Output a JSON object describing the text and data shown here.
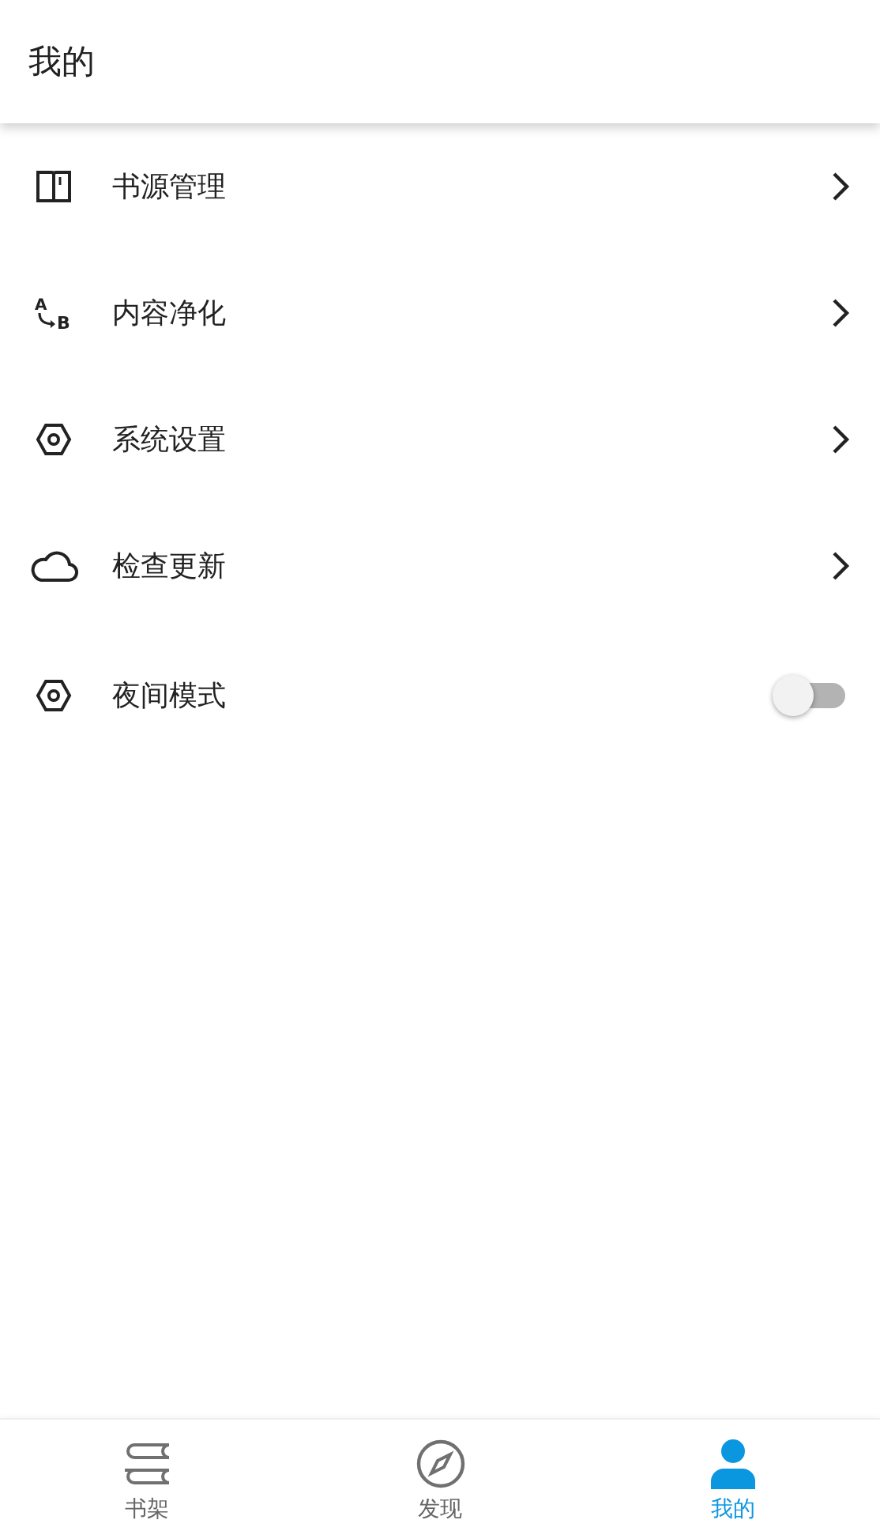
{
  "header": {
    "title": "我的"
  },
  "items": [
    {
      "kind": "link",
      "label": "书源管理"
    },
    {
      "kind": "link",
      "icon_letters": [
        "A",
        "B"
      ],
      "label": "内容净化"
    },
    {
      "kind": "link",
      "label": "系统设置"
    },
    {
      "kind": "link",
      "label": "检查更新"
    },
    {
      "kind": "switch",
      "label": "夜间模式",
      "on": false
    }
  ],
  "nav": [
    {
      "label": "书架",
      "selected": false
    },
    {
      "label": "发现",
      "selected": false
    },
    {
      "label": "我的",
      "selected": true
    }
  ]
}
